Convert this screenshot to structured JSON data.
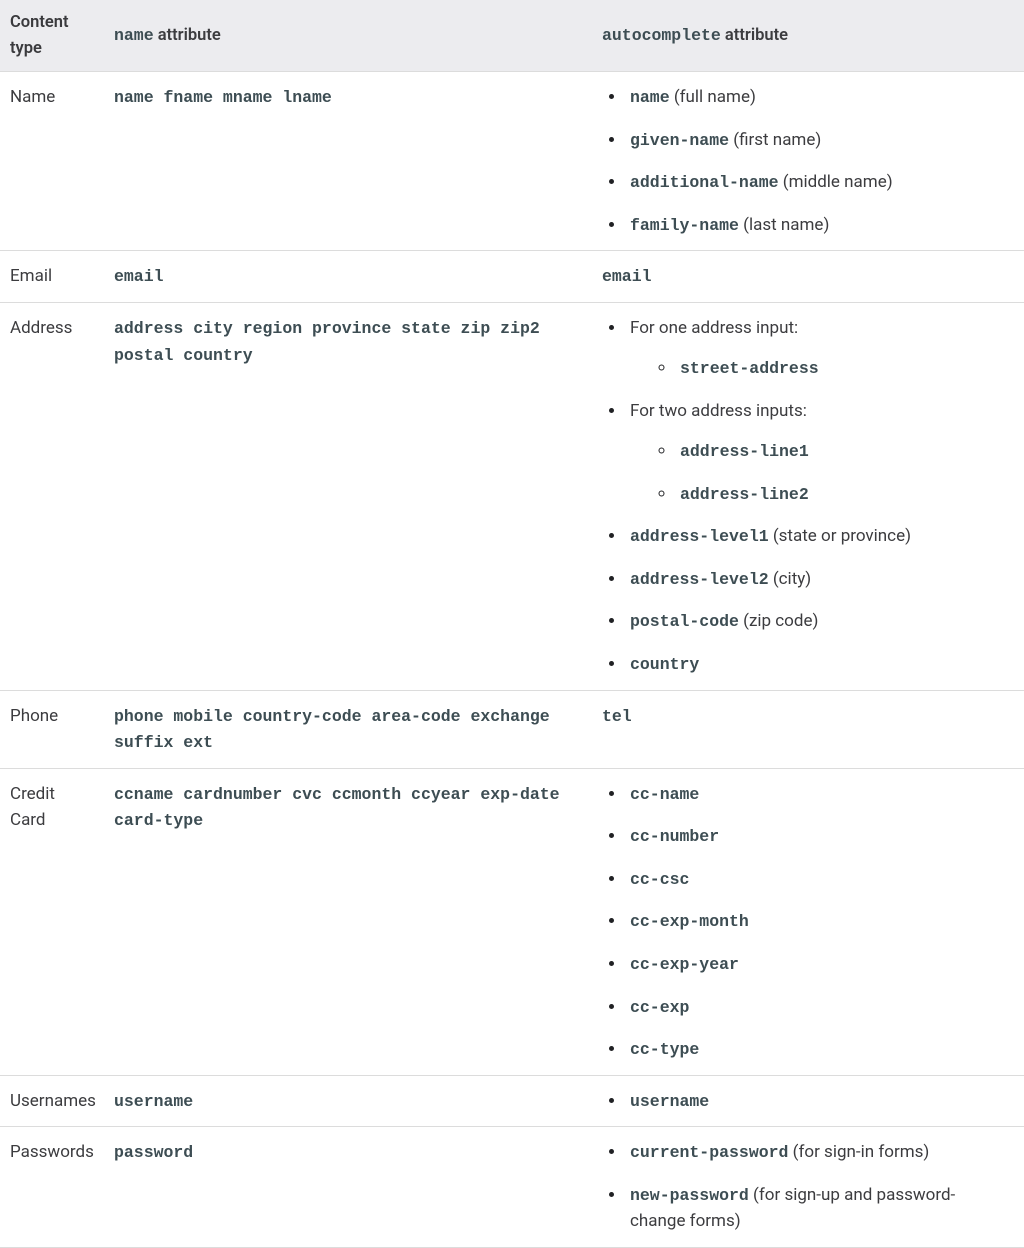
{
  "headers": {
    "content_type": "Content type",
    "name_attr_code": "name",
    "name_attr_text": " attribute",
    "ac_attr_code": "autocomplete",
    "ac_attr_text": " attribute"
  },
  "rows": {
    "name": {
      "label": "Name",
      "name_attr": "name fname mname lname",
      "items": [
        {
          "code": "name",
          "note": " (full name)"
        },
        {
          "code": "given-name",
          "note": " (first name)"
        },
        {
          "code": "additional-name",
          "note": " (middle name)"
        },
        {
          "code": "family-name",
          "note": " (last name)"
        }
      ]
    },
    "email": {
      "label": "Email",
      "name_attr": "email",
      "ac_code": "email"
    },
    "address": {
      "label": "Address",
      "name_attr": "address city region province state zip zip2 postal country",
      "intro1": "For one address input:",
      "sub1": [
        "street-address"
      ],
      "intro2": "For two address inputs:",
      "sub2": [
        "address-line1",
        "address-line2"
      ],
      "rest": [
        {
          "code": "address-level1",
          "note": " (state or province)"
        },
        {
          "code": "address-level2",
          "note": " (city)"
        },
        {
          "code": "postal-code",
          "note": " (zip code)"
        },
        {
          "code": "country",
          "note": ""
        }
      ]
    },
    "phone": {
      "label": "Phone",
      "name_attr": "phone mobile country-code area-code exchange suffix ext",
      "ac_code": "tel"
    },
    "cc": {
      "label": "Credit Card",
      "name_attr": "ccname cardnumber cvc ccmonth ccyear exp-date card-type",
      "items": [
        "cc-name",
        "cc-number",
        "cc-csc",
        "cc-exp-month",
        "cc-exp-year",
        "cc-exp",
        "cc-type"
      ]
    },
    "user": {
      "label": "Usernames",
      "name_attr": "username",
      "items": [
        "username"
      ]
    },
    "pass": {
      "label": "Passwords",
      "name_attr": "password",
      "items": [
        {
          "code": "current-password",
          "note": " (for sign-in forms)"
        },
        {
          "code": "new-password",
          "note": " (for sign-up and password-change forms)"
        }
      ]
    }
  }
}
